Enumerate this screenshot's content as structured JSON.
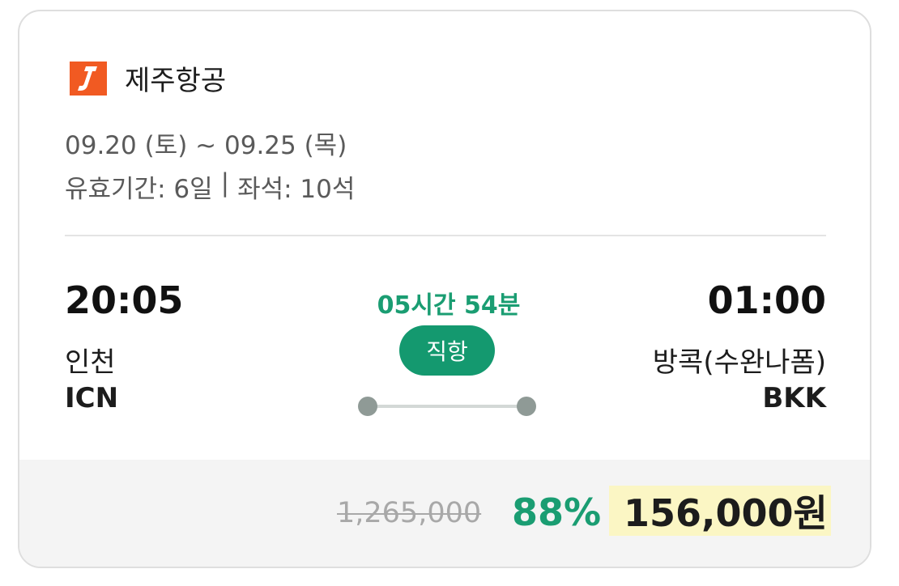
{
  "airline": {
    "name": "제주항공",
    "logo_letter": "J",
    "logo_color": "#f15a22"
  },
  "dates": "09.20 (토) ~ 09.25 (목)",
  "validity": {
    "period": "유효기간: 6일",
    "separator": "|",
    "seats": "좌석: 10석"
  },
  "departure": {
    "time": "20:05",
    "city": "인천",
    "code": "ICN"
  },
  "arrival": {
    "time": "01:00",
    "city": "방콕(수완나폼)",
    "code": "BKK"
  },
  "flight": {
    "duration": "05시간 54분",
    "type": "직항"
  },
  "price": {
    "original": "1,265,000",
    "discount": "88%",
    "final": "156,000원"
  },
  "colors": {
    "accent_green": "#1a9d72",
    "highlight": "#fbf6c4"
  }
}
